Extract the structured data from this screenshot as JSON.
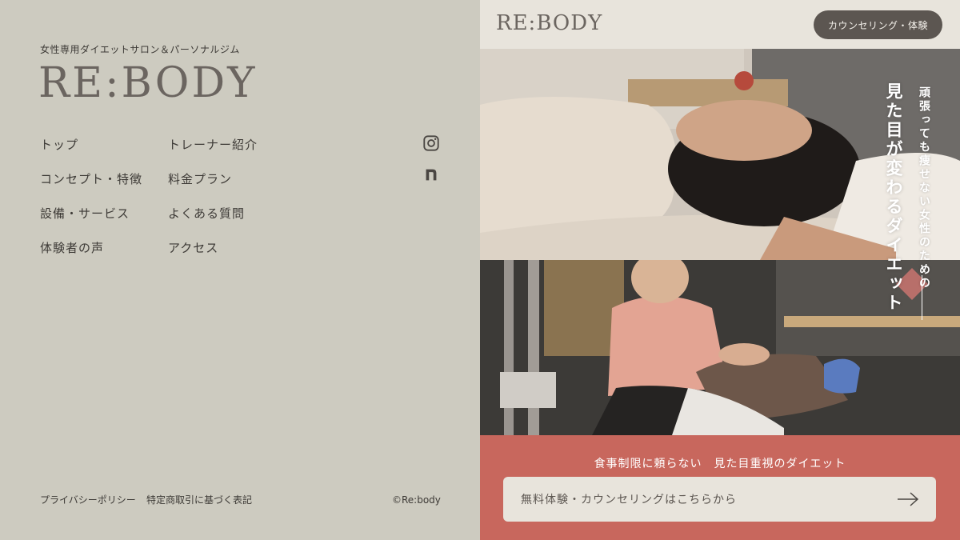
{
  "left": {
    "tagline": "女性専用ダイエットサロン＆パーソナルジム",
    "logo": "RE:BODY",
    "nav": {
      "col1": [
        "トップ",
        "コンセプト・特徴",
        "設備・サービス",
        "体験者の声"
      ],
      "col2": [
        "トレーナー紹介",
        "料金プラン",
        "よくある質問",
        "アクセス"
      ]
    },
    "social": [
      {
        "icon": "instagram-icon"
      },
      {
        "icon": "note-icon",
        "glyph": "n"
      }
    ],
    "footer": {
      "privacy": "プライバシーポリシー",
      "tokutei": "特定商取引に基づく表記",
      "copyright": "©Re:body"
    }
  },
  "right": {
    "header": {
      "logo": "RE:BODY",
      "button": "カウンセリング・体験"
    },
    "headline": {
      "sub": "頑張っても痩せない女性のための",
      "main": "見た目が変わるダイエット"
    },
    "cta": {
      "text": "食事制限に頼らない　見た目重視のダイエット",
      "button": "無料体験・カウンセリングはこちらから"
    }
  },
  "colors": {
    "left_bg": "#cdcbc0",
    "right_bg": "#e8e4dc",
    "cta_bg": "#c8675d",
    "button_dark": "#5c5651",
    "logo": "#6b6560"
  }
}
